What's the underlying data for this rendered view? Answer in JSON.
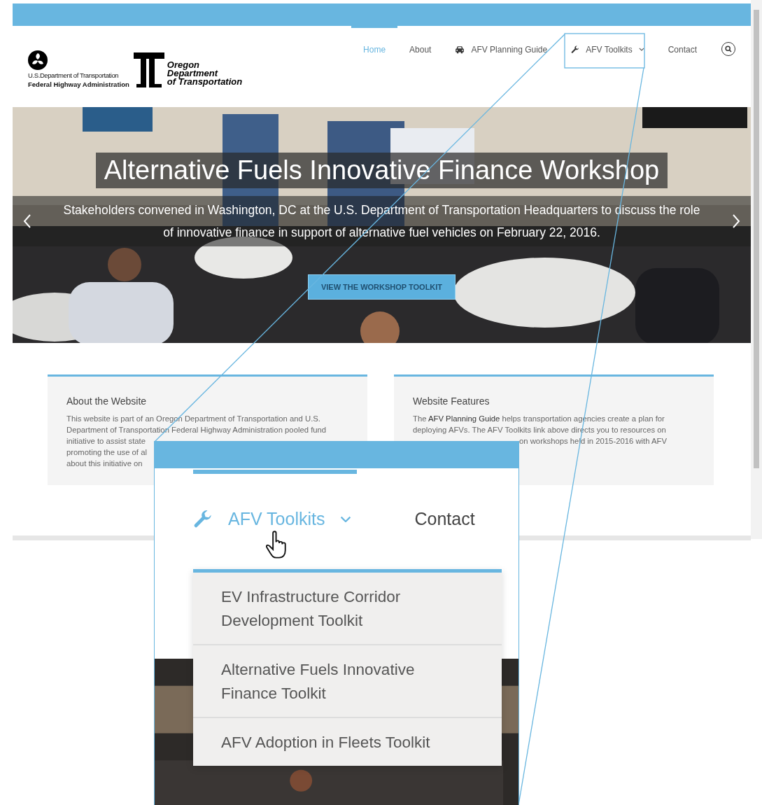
{
  "logos": {
    "fhwa_lines": [
      "U.S.Department of Transportation",
      "Federal Highway Administration"
    ],
    "odot_lines": [
      "Oregon",
      "Department",
      "of Transportation"
    ]
  },
  "nav": [
    {
      "label": "Home",
      "selected": true
    },
    {
      "label": "About",
      "selected": false
    },
    {
      "label": "AFV Planning Guide",
      "selected": false,
      "kind": "car"
    },
    {
      "label": "AFV Toolkits",
      "selected": false,
      "kind": "wrench",
      "dropdown": true
    },
    {
      "label": "Contact",
      "selected": false
    }
  ],
  "hero": {
    "title": "Alternative Fuels Innovative Finance Workshop",
    "subtitle": "Stakeholders convened in Washington, DC at the U.S. Department of Transportation Headquarters to discuss the role of innovative finance in support of alternative fuel vehicles on February 22, 2016.",
    "button": "VIEW THE WORKSHOP TOOLKIT"
  },
  "cards": [
    {
      "title": "About the Website",
      "lines": [
        "This website is part of an Oregon Department of Transportation and U.S.",
        "Department of Transportation Federal Highway Administration pooled fund",
        "initiative to assist state",
        "promoting the use of al",
        "about this initiative on"
      ]
    },
    {
      "title": "Website Features",
      "lines": [
        "The **AFV Planning Guide** helps transportation agencies create a plan for",
        "deploying AFVs. The AFV Toolkits link above directs you to resources on",
        "on workshops held in 2015-2016 with AFV"
      ]
    }
  ],
  "zoom_callout": {
    "nav": [
      {
        "label": "AFV Toolkits",
        "selected": true,
        "kind": "wrench",
        "dropdown": true
      },
      {
        "label": "Contact",
        "selected": false
      }
    ],
    "menu": [
      "EV Infrastructure Corridor Development Toolkit",
      "Alternative Fuels Innovative Finance Toolkit",
      "AFV Adoption in Fleets Toolkit"
    ]
  }
}
